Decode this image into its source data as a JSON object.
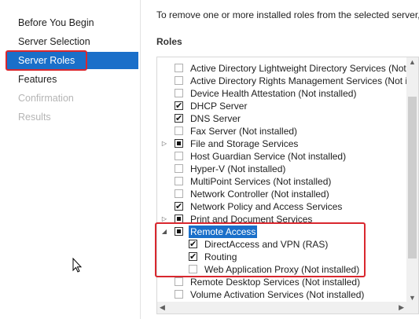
{
  "nav": {
    "items": [
      {
        "label": "Before You Begin",
        "state": "normal"
      },
      {
        "label": "Server Selection",
        "state": "normal"
      },
      {
        "label": "Server Roles",
        "state": "active"
      },
      {
        "label": "Features",
        "state": "normal"
      },
      {
        "label": "Confirmation",
        "state": "disabled"
      },
      {
        "label": "Results",
        "state": "disabled"
      }
    ]
  },
  "intro_text": "To remove one or more installed roles from the selected server,",
  "roles_heading": "Roles",
  "roles": [
    {
      "label": "Active Directory Lightweight Directory Services (Not installed)",
      "state": "unchecked",
      "level": 0
    },
    {
      "label": "Active Directory Rights Management Services (Not installed)",
      "state": "unchecked",
      "level": 0
    },
    {
      "label": "Device Health Attestation (Not installed)",
      "state": "unchecked",
      "level": 0
    },
    {
      "label": "DHCP Server",
      "state": "checked",
      "level": 0
    },
    {
      "label": "DNS Server",
      "state": "checked",
      "level": 0
    },
    {
      "label": "Fax Server (Not installed)",
      "state": "unchecked",
      "level": 0
    },
    {
      "label": "File and Storage Services",
      "state": "partial",
      "level": 0,
      "expander": "collapsed"
    },
    {
      "label": "Host Guardian Service (Not installed)",
      "state": "unchecked",
      "level": 0
    },
    {
      "label": "Hyper-V (Not installed)",
      "state": "unchecked",
      "level": 0
    },
    {
      "label": "MultiPoint Services (Not installed)",
      "state": "unchecked",
      "level": 0
    },
    {
      "label": "Network Controller (Not installed)",
      "state": "unchecked",
      "level": 0
    },
    {
      "label": "Network Policy and Access Services",
      "state": "checked",
      "level": 0
    },
    {
      "label": "Print and Document Services",
      "state": "partial",
      "level": 0,
      "expander": "collapsed"
    },
    {
      "label": "Remote Access",
      "state": "partial",
      "level": 0,
      "expander": "expanded",
      "selected": true
    },
    {
      "label": "DirectAccess and VPN (RAS)",
      "state": "checked",
      "level": 1
    },
    {
      "label": "Routing",
      "state": "checked",
      "level": 1
    },
    {
      "label": "Web Application Proxy (Not installed)",
      "state": "unchecked",
      "level": 1
    },
    {
      "label": "Remote Desktop Services (Not installed)",
      "state": "unchecked",
      "level": 0
    },
    {
      "label": "Volume Activation Services (Not installed)",
      "state": "unchecked",
      "level": 0
    }
  ],
  "colors": {
    "accent": "#1a6fc9",
    "highlight": "#d9272e"
  },
  "icons": {
    "collapsed": "triangle-right-icon",
    "expanded": "triangle-down-icon",
    "cursor": "mouse-pointer-icon"
  }
}
